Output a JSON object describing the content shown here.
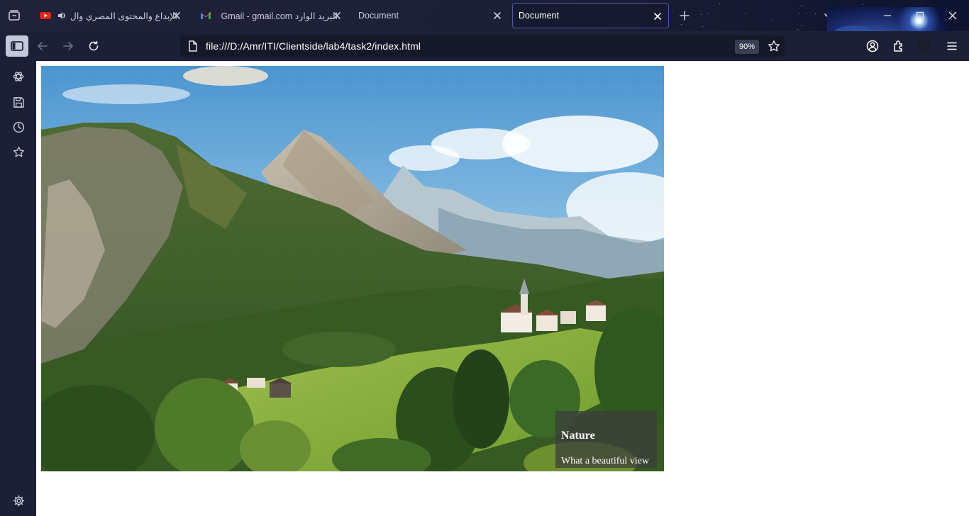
{
  "browser": {
    "tabs": [
      {
        "title": "الإبداع والمحتوى المصري وال",
        "favicon": "youtube-icon",
        "audio": true,
        "active": false
      },
      {
        "title": "البريد الوارد Gmail - gmail.com",
        "favicon": "gmail-icon",
        "audio": false,
        "active": false
      },
      {
        "title": "Document",
        "favicon": "",
        "audio": false,
        "active": false
      },
      {
        "title": "Document",
        "favicon": "",
        "audio": false,
        "active": true
      }
    ],
    "address_bar": {
      "url": "file:///D:/Amr/ITI/Clientside/lab4/task2/index.html",
      "zoom": "90%"
    },
    "colors": {
      "chrome_bg": "#1c2036",
      "active_tab_border": "#4a5aa8",
      "page_bg": "#ffffff"
    }
  },
  "sidebar": {
    "items": [
      {
        "icon": "ai-assistant-icon"
      },
      {
        "icon": "save-icon"
      },
      {
        "icon": "history-icon"
      },
      {
        "icon": "bookmarks-icon"
      },
      {
        "icon": "settings-icon"
      }
    ]
  },
  "page": {
    "figure": {
      "image_subject": "mountain-valley-landscape",
      "caption_title": "Nature",
      "caption_text": "What a beautiful view"
    }
  }
}
